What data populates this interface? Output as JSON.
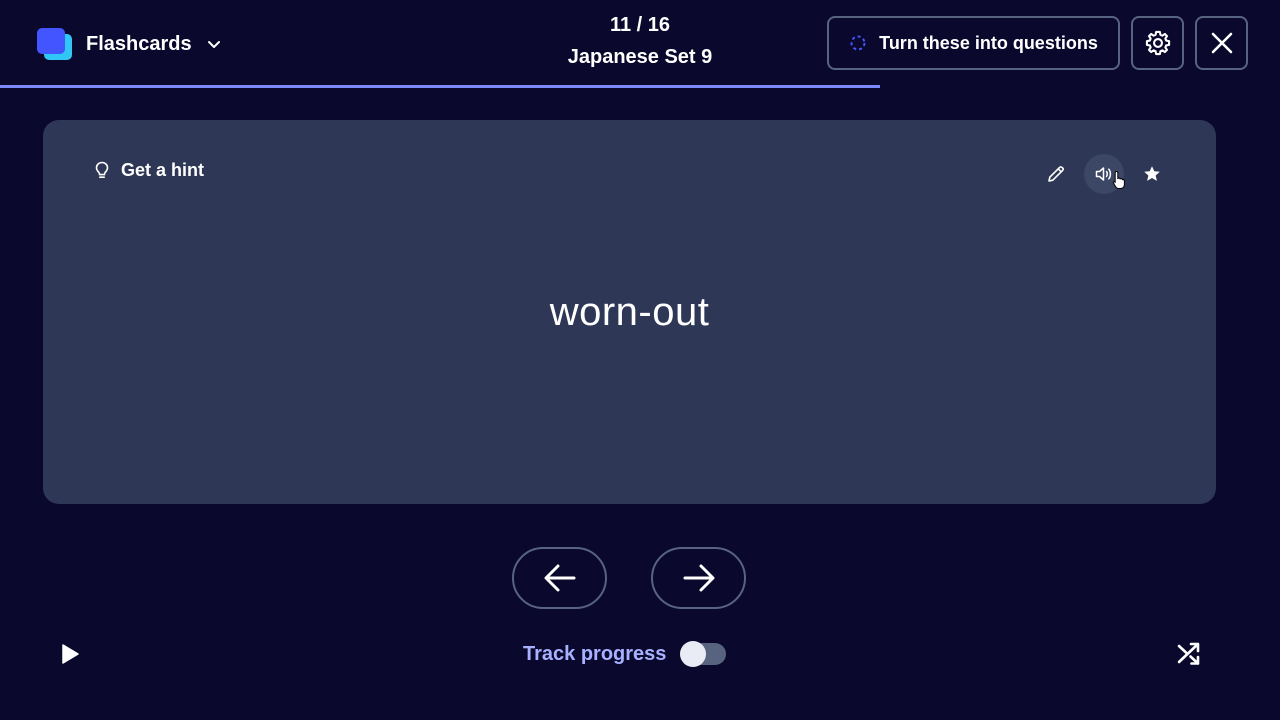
{
  "header": {
    "mode_label": "Flashcards",
    "counter": "11 / 16",
    "set_title": "Japanese Set 9",
    "turn_into_questions_label": "Turn these into questions",
    "progress_fraction": 0.6875
  },
  "card": {
    "hint_label": "Get a hint",
    "term": "worn-out",
    "actions": [
      "edit-icon",
      "speaker-icon",
      "star-icon"
    ]
  },
  "footer": {
    "track_progress_label": "Track progress",
    "track_progress_enabled": false
  },
  "colors": {
    "background": "#0a092d",
    "card": "#2e3856",
    "border": "#586380",
    "accent": "#4255ff",
    "accent_light": "#a8b1ff",
    "progress": "#7b89ff"
  }
}
